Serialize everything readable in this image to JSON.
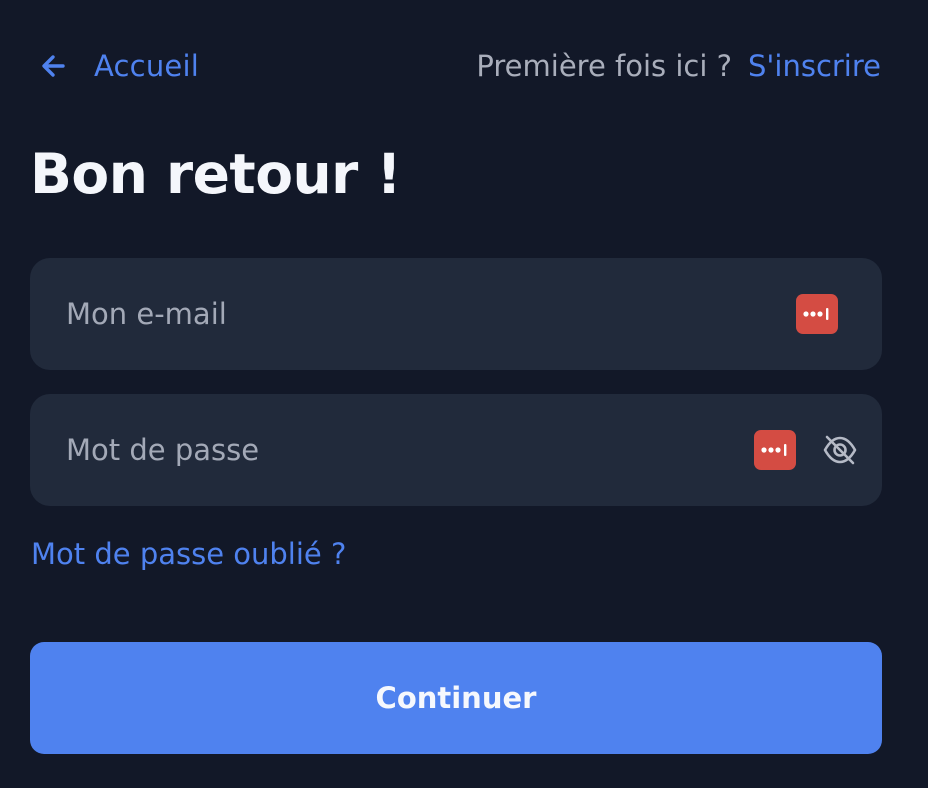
{
  "header": {
    "back_label": "Accueil",
    "back_icon": "arrow-left-icon",
    "signup_prompt": "Première fois ici ?",
    "signup_link": "S'inscrire"
  },
  "title": "Bon retour !",
  "form": {
    "email_placeholder": "Mon e-mail",
    "email_value": "",
    "password_placeholder": "Mot de passe",
    "password_value": "",
    "password_manager_icon": "password-manager-icon",
    "visibility_icon": "eye-off-icon",
    "forgot_link": "Mot de passe oublié ?",
    "submit_label": "Continuer"
  },
  "colors": {
    "background": "#121828",
    "field_background": "#212a3b",
    "accent": "#4f82ef",
    "password_manager": "#d44c43",
    "heading": "#f4f6fb",
    "muted_text": "#a9aebb"
  }
}
